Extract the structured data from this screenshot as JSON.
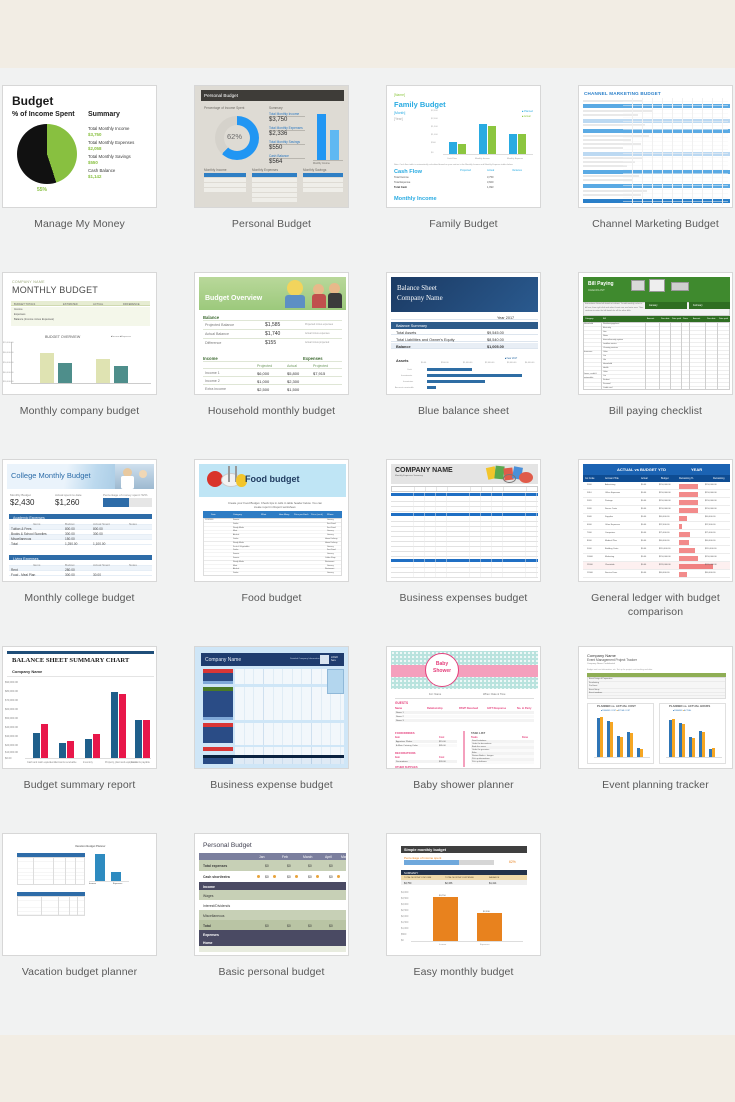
{
  "page": {
    "background_top": "#f2ede4",
    "background_gallery": "#f1f2f2",
    "background_bottom": "#f2ede4"
  },
  "templates": [
    {
      "id": "manage-my-money",
      "caption": "Manage My Money",
      "title": "Budget",
      "section_left": "% of Income Spent",
      "section_right": "Summary",
      "pie_label": "55%",
      "summary": [
        {
          "label": "Total Monthly Income",
          "value": "$3,750"
        },
        {
          "label": "Total Monthly Expenses",
          "value": "$2,058"
        },
        {
          "label": "Total Monthly Savings",
          "value": "$550"
        },
        {
          "label": "Cash Balance",
          "value": "$1,142"
        }
      ],
      "colors": {
        "accent": "#88c040",
        "dark": "#111111"
      }
    },
    {
      "id": "personal-budget",
      "caption": "Personal Budget",
      "header": "Personal Budget",
      "left_label": "Percentage of Income Spent",
      "right_label": "Summary",
      "donut_value": "62%",
      "summary": [
        {
          "label": "Total Monthly Income",
          "value": "$3,750"
        },
        {
          "label": "Total Monthly Expenses",
          "value": "$2,336"
        },
        {
          "label": "Total Monthly Savings",
          "value": "$550"
        },
        {
          "label": "Cash Balance",
          "value": "$564"
        }
      ],
      "tables": [
        "Monthly Income",
        "Monthly Expenses",
        "Monthly Savings"
      ],
      "col_headers": [
        "ITEM",
        "ACTUAL",
        "BUDGET"
      ],
      "colors": {
        "accent": "#2196f3",
        "bg": "#dedbd4",
        "header": "#3e3c38"
      }
    },
    {
      "id": "family-budget",
      "caption": "Family Budget",
      "name_placeholder": "[Name]",
      "title": "Family Budget",
      "month_placeholder": "[Month]",
      "year_placeholder": "[Year]",
      "legend": [
        "Planned",
        "Actual"
      ],
      "chart_categories": [
        "Cash Flow",
        "Monthly Income",
        "Monthly Expense"
      ],
      "sections": [
        "Cash Flow",
        "Monthly Income"
      ],
      "cashflow_rows": [
        {
          "label": "Total Income",
          "planned": "3,750",
          "actual": "3,750",
          "variance": "-100"
        },
        {
          "label": "Total Expense",
          "planned": "3,600",
          "actual": "3,600",
          "variance": "-32"
        },
        {
          "label": "Total Cash",
          "planned": "2,097",
          "actual": "1,993",
          "variance": "-152"
        }
      ],
      "col_headers": [
        "Projected",
        "Actual",
        "Variance"
      ],
      "colors": {
        "accent": "#29abe2",
        "green": "#8cc63f"
      }
    },
    {
      "id": "channel-marketing-budget",
      "caption": "Channel Marketing Budget",
      "title": "CHANNEL MARKETING BUDGET",
      "colors": {
        "accent": "#2a7fc9",
        "band": "#5aaae4"
      }
    },
    {
      "id": "monthly-company-budget",
      "caption": "Monthly company budget",
      "company": "COMPANY NAME",
      "title": "MONTHLY BUDGET",
      "table_title": "BUDGET TOTALS",
      "col_headers": [
        "ESTIMATED",
        "ACTUAL",
        "DIFFERENCE"
      ],
      "rows": [
        "Income",
        "Expenses",
        "Balance (Income minus Expenses)"
      ],
      "chart_title": "BUDGET OVERVIEW",
      "legend": [
        "Income",
        "Expenses"
      ],
      "y_ticks": [
        "$30,000.00",
        "$40,000.00",
        "$50,000.00",
        "$60,000.00",
        "$70,000.00"
      ],
      "colors": {
        "income": "#dfe3b2",
        "expenses": "#4e8e8b"
      }
    },
    {
      "id": "household-monthly-budget",
      "caption": "Household monthly budget",
      "title": "Budget Overview",
      "balance_section": "Balance",
      "balance_rows": [
        {
          "label": "Projected Balance",
          "value": "$1,585",
          "note": "Projected minus expenses"
        },
        {
          "label": "Actual Balance",
          "value": "$1,740",
          "note": "Actual minus expenses"
        },
        {
          "label": "Difference",
          "value": "$155",
          "note": "Actual minus projected"
        }
      ],
      "income_section": "Income",
      "expenses_section": "Expenses",
      "col_headers": [
        "Projected",
        "Actual",
        "Projected"
      ],
      "income_rows": [
        {
          "label": "Income 1",
          "projected": "$6,000",
          "actual": "$5,800"
        },
        {
          "label": "Income 2",
          "projected": "$1,000",
          "actual": "$2,300"
        },
        {
          "label": "Extra income",
          "projected": "$2,500",
          "actual": "$1,500"
        }
      ],
      "expense_value": "$7,915",
      "colors": {
        "header": "#9cc97c",
        "text": "#3f6b33"
      }
    },
    {
      "id": "blue-balance-sheet",
      "caption": "Blue balance sheet",
      "title": "Balance Sheet",
      "subtitle": "Company Name",
      "year": "Year 2017",
      "section": "Balance Summary",
      "rows": [
        {
          "label": "Total Assets",
          "value": "$9,545.00"
        },
        {
          "label": "Total Liabilities and Owner's Equity",
          "value": "$8,540.00"
        },
        {
          "label": "Balance",
          "value": "$1,005.00"
        }
      ],
      "chart_section": "Assets",
      "legend": "Year 2017",
      "chart_x_ticks": [
        "$0.00",
        "$500.00",
        "$1,000.00",
        "$2,000.00",
        "$3,000.00",
        "$4,000.00"
      ],
      "chart_categories": [
        "Cash",
        "Investments",
        "Inventories",
        "Accounts receivable"
      ],
      "colors": {
        "header": "#1b3a63",
        "band": "#2e5c8a",
        "bar": "#2e6da4"
      }
    },
    {
      "id": "bill-paying-checklist",
      "caption": "Bill paying checklist",
      "title": "Bill Paying",
      "subtitle": "CHECKLIST",
      "months": [
        "January",
        "February"
      ],
      "col_headers": [
        "Category",
        "Bill",
        "Amount",
        "Due date",
        "Date paid",
        "Done",
        "Amount",
        "Due date",
        "Date paid"
      ],
      "categories": [
        "Household",
        "Insurance",
        "Loans, credit & automobile"
      ],
      "bills": [
        "Rent/mortgage/rent",
        "Electricity",
        "Gas",
        "Water",
        "Internet/security system",
        "Landline service",
        "Cleaning services",
        "Other",
        "Car",
        "Life",
        "Household",
        "Health",
        "Other",
        "Car",
        "Student",
        "Personal",
        "Credit card",
        "Other"
      ],
      "colors": {
        "header": "#3f8a2e",
        "table_header": "#2f6e22"
      }
    },
    {
      "id": "monthly-college-budget",
      "caption": "Monthly college budget",
      "title": "College Monthly Budget",
      "kpis": [
        {
          "label": "Monthly Budget",
          "value": "$2,430"
        },
        {
          "label": "Actual spent to date",
          "value": "$1,260"
        },
        {
          "label": "Percentage of money spent: 52%",
          "value": ""
        }
      ],
      "sections": [
        "Academic Expenses",
        "Living Expenses"
      ],
      "col_headers": [
        "Items",
        "Budget",
        "Actual Spent",
        "Notes"
      ],
      "academic_rows": [
        {
          "label": "Tuition & Fees",
          "budget": "800.00",
          "actual": "800.00"
        },
        {
          "label": "Books & School Supplies",
          "budget": "300.00",
          "actual": "300.00"
        },
        {
          "label": "Miscellaneous",
          "budget": "150.00",
          "actual": ""
        },
        {
          "label": "Total",
          "budget": "1,250.00",
          "actual": "1,100.00"
        }
      ],
      "living_rows": [
        {
          "label": "Rent",
          "budget": "280.00",
          "actual": ""
        },
        {
          "label": "Food - Meal Plan",
          "budget": "300.00",
          "actual": "30.00"
        }
      ],
      "colors": {
        "accent": "#2e6ca8"
      }
    },
    {
      "id": "food-budget",
      "caption": "Food budget",
      "title": "Food budget",
      "note": "Create your Food Budget. Check tips in cells in table header below. You can create report in Report worksheet.",
      "col_headers": [
        "Date",
        "Category",
        "What",
        "How Many",
        "Price per Each",
        "Price (each)",
        "Where"
      ],
      "categories": [
        "Sweets",
        "Drinks",
        "Ready Meals",
        "Meat",
        "Alcohol",
        "Drinks",
        "Ready Meals",
        "Fruits & Vegetables",
        "Drinks",
        "Sweets",
        "Sweets",
        "Ready Meals",
        "Meat",
        "Alcohol",
        "Drinks"
      ],
      "places": [
        "Grocery",
        "Fast Food",
        "Fast Food",
        "Grocery",
        "Grocery",
        "Home Delivery",
        "Home Delivery",
        "Grocery",
        "Fast Food",
        "Grocery",
        "Coffee Shop",
        "Restaurant",
        "Grocery",
        "Restaurant",
        "Grocery"
      ],
      "colors": {
        "hero": "#bfe5f5",
        "header": "#2e7cc4"
      }
    },
    {
      "id": "business-expenses-budget",
      "caption": "Business expenses budget",
      "title": "COMPANY NAME",
      "subtitle": "Monthly Expenses Summary",
      "col_headers": [
        "Jan",
        "Feb",
        "Mar",
        "Apr",
        "May",
        "Jun",
        "Jul",
        "Aug",
        "Sep",
        "Oct",
        "Nov",
        "Dec",
        "Total"
      ],
      "colors": {
        "band": "#1f6fc4",
        "hero": "#e4e4e4"
      }
    },
    {
      "id": "general-ledger-budget-comparison",
      "caption": "General ledger with budget comparison",
      "title_left": "ACTUAL vs BUDGET YTD",
      "title_right": "YEAR",
      "col_headers": [
        "GL Code",
        "Account Title",
        "Actual",
        "Budget",
        "Remaining %",
        "Remaining"
      ],
      "rows": [
        {
          "code": "5000",
          "title": "Advertising",
          "actual": "$0.00",
          "budget": "$150,000.00",
          "remaining": "$150,000.00",
          "pct": 62
        },
        {
          "code": "5010",
          "title": "Office Expenses",
          "actual": "$0.00",
          "budget": "$150,000.00",
          "remaining": "$150,000.00",
          "pct": 62
        },
        {
          "code": "5020",
          "title": "Postage",
          "actual": "$0.00",
          "budget": "$150,000.00",
          "remaining": "$150,000.00",
          "pct": 62
        },
        {
          "code": "5030",
          "title": "Server Costs",
          "actual": "$0.00",
          "budget": "$150,000.00",
          "remaining": "$150,000.00",
          "pct": 62
        },
        {
          "code": "5040",
          "title": "Supplies",
          "actual": "$0.00",
          "budget": "$60,000.00",
          "remaining": "$60,000.00",
          "pct": 26
        },
        {
          "code": "6000",
          "title": "Other Expenses",
          "actual": "$0.00",
          "budget": "$22,000.00",
          "remaining": "$22,000.00",
          "pct": 10
        },
        {
          "code": "7000",
          "title": "Computers",
          "actual": "$0.00",
          "budget": "$75,000.00",
          "remaining": "$75,000.00",
          "pct": 34
        },
        {
          "code": "8000",
          "title": "Medical Plan",
          "actual": "$0.00",
          "budget": "$60,000.00",
          "remaining": "$60,000.00",
          "pct": 30
        },
        {
          "code": "9000",
          "title": "Building Costs",
          "actual": "$0.00",
          "budget": "$110,000.00",
          "remaining": "$110,000.00",
          "pct": 52
        },
        {
          "code": "10000",
          "title": "Marketing",
          "actual": "$0.00",
          "budget": "$150,000.00",
          "remaining": "$150,000.00",
          "pct": 62
        },
        {
          "code": "11000",
          "title": "Charitable",
          "actual": "$0.00",
          "budget": "$220,000.00",
          "remaining": "$220,000.00",
          "pct": 92
        },
        {
          "code": "12000",
          "title": "Service Fees",
          "actual": "$0.00",
          "budget": "$60,000.00",
          "remaining": "$60,000.00",
          "pct": 24
        }
      ],
      "colors": {
        "header": "#1b63b3",
        "subheader": "#0e4c92",
        "bar": "#f28b8b"
      }
    },
    {
      "id": "budget-summary-report",
      "caption": "Budget summary report",
      "title": "BALANCE SHEET SUMMARY CHART",
      "company": "Company Name",
      "y_ticks": [
        "$0.00",
        "$10,000.00",
        "$20,000.00",
        "$30,000.00",
        "$40,000.00",
        "$50,000.00",
        "$60,000.00",
        "$70,000.00",
        "$80,000.00",
        "$90,000.00"
      ],
      "categories": [
        "Cash and cash equivalents",
        "Accounts receivable",
        "Inventory",
        "Property, plant and equipment",
        "Accounts payable"
      ],
      "series": [
        {
          "name": "Series 1",
          "color": "#1f5f8b",
          "values": [
            28000,
            17000,
            22000,
            75000,
            43000
          ]
        },
        {
          "name": "Series 2",
          "color": "#e8174a",
          "values": [
            38000,
            19000,
            27000,
            73000,
            43000
          ]
        }
      ],
      "colors": {
        "top_band": "#1f4e79"
      }
    },
    {
      "id": "business-expense-budget",
      "caption": "Business expense budget",
      "title": "Company Name",
      "note": "Detailed Company Information",
      "sections": [
        "PERSONNEL COSTS",
        "TRAVEL",
        "OVERHEAD / RENT",
        "SUPPLIES & SERVICES",
        "TOTALS"
      ],
      "colors": {
        "bg": "#cfe6f7",
        "header": "#1f3c6e",
        "red": "#d93636",
        "green": "#4a7a27"
      }
    },
    {
      "id": "baby-shower-planner",
      "caption": "Baby shower planner",
      "title": "Baby Shower",
      "fields": [
        "For: Name",
        "When: Date & Time"
      ],
      "section_guests": "GUESTS",
      "guest_headers": [
        "Name",
        "Relationship",
        "RSVP Received",
        "GIFT Response",
        "No. in Party"
      ],
      "guest_rows": [
        "Name 1",
        "Name 2",
        "Name 3"
      ],
      "section_food": "FOOD/DRINKS",
      "food_headers": [
        "Item",
        "Cost"
      ],
      "food_rows": [
        {
          "label": "Appetizer Platter",
          "cost": "$15.00"
        },
        {
          "label": "A Main Catering Order",
          "cost": "$85.00"
        }
      ],
      "section_decorations": "DECORATIONS",
      "decoration_rows": [
        {
          "label": "Decorations",
          "cost": "$20.00"
        }
      ],
      "section_supplies": "OTHER SUPPLIES",
      "section_tasks": "TASK LIST",
      "task_headers": [
        "Tasks",
        "Done"
      ],
      "tasks": [
        "Send Invitations",
        "Order the decorations",
        "Book the venue",
        "Order the groceries",
        "Bake",
        "Review Books + Images",
        "Pick up decorations",
        "Pick up balloons",
        "Reserve an extra chair",
        "Decorate Furniture",
        "Set Furniture"
      ],
      "colors": {
        "teal": "#b9e3de",
        "pink": "#f4a0bd",
        "accent": "#e4407c"
      }
    },
    {
      "id": "event-planning-tracker",
      "caption": "Event planning tracker",
      "company": "Company Name",
      "title": "Event Management Project Tracker",
      "confidential": "Company Name Confidential",
      "chart_left_title": "PLANNED vs. ACTUAL COST",
      "chart_right_title": "PLANNED vs. ACTUAL HOURS",
      "legend": [
        "PLANNED COST",
        "ACTUAL COST"
      ],
      "categories": [
        "Event Design & Preparation",
        "Fundraising",
        "Pre Event",
        "Event Setup",
        "Event Setup",
        "Event teardown"
      ],
      "series": [
        {
          "name": "Planned",
          "color": "#2e75b6",
          "values": [
            95,
            88,
            52,
            60,
            22,
            16
          ]
        },
        {
          "name": "Actual",
          "color": "#f5a623",
          "values": [
            97,
            86,
            50,
            58,
            20,
            15
          ]
        }
      ],
      "colors": {
        "table_header": "#8fae55"
      }
    },
    {
      "id": "vacation-budget-planner",
      "caption": "Vacation budget planner",
      "chart_title": "Vacation Budget Planner",
      "colors": {
        "header": "#2e6ca8",
        "bar": "#2e8bc0"
      }
    },
    {
      "id": "basic-personal-budget",
      "caption": "Basic personal budget",
      "title": "Personal Budget",
      "col_headers": [
        "Jan",
        "Feb",
        "March",
        "April",
        "May"
      ],
      "rows": [
        {
          "label": "Total expenses",
          "type": "green",
          "values": [
            "$0",
            "$0",
            "$0",
            "$0"
          ]
        },
        {
          "label": "Cash short/extra",
          "type": "white",
          "values": [
            "$0",
            "$0",
            "$0",
            "$0"
          ]
        },
        {
          "label": "Income",
          "type": "dark",
          "values": []
        },
        {
          "label": "Wages",
          "type": "green",
          "values": []
        },
        {
          "label": "Interest/Dividends",
          "type": "white",
          "values": []
        },
        {
          "label": "Miscellaneous",
          "type": "green",
          "values": []
        },
        {
          "label": "Total",
          "type": "green",
          "values": [
            "$0",
            "$0",
            "$0",
            "$0"
          ]
        },
        {
          "label": "Expenses",
          "type": "dark",
          "values": []
        },
        {
          "label": "Home",
          "type": "dark",
          "values": []
        }
      ],
      "colors": {
        "header": "#7b7f9e",
        "green": "#c7d0b6",
        "dark": "#4a4a63",
        "dot": "#e8a33d"
      }
    },
    {
      "id": "easy-monthly-budget",
      "caption": "Easy monthly budget",
      "title": "Simple monthly budget",
      "progress_label": "Percentage of income spent",
      "progress_value": "62%",
      "summary_header": "SUMMARY",
      "summary_cols": [
        "TOTAL MONTHLY INCOME",
        "TOTAL MONTHLY EXPENSE",
        "BALANCE"
      ],
      "summary_vals": [
        "$3,750",
        "$2,336",
        "$1,414"
      ],
      "chart_categories": [
        "Income",
        "Expenses"
      ],
      "chart_values": [
        3750,
        2336
      ],
      "chart_labels": [
        "$3,750",
        "$2,336"
      ],
      "y_ticks": [
        "$0",
        "$500",
        "$1,000",
        "$1,500",
        "$2,000",
        "$2,500",
        "$3,000",
        "$3,500",
        "$4,000"
      ],
      "colors": {
        "bar": "#e8821e",
        "header": "#3f3f3f",
        "summary": "#22324a",
        "tan": "#efd9a8",
        "progress": "#6fa8dc"
      }
    }
  ]
}
